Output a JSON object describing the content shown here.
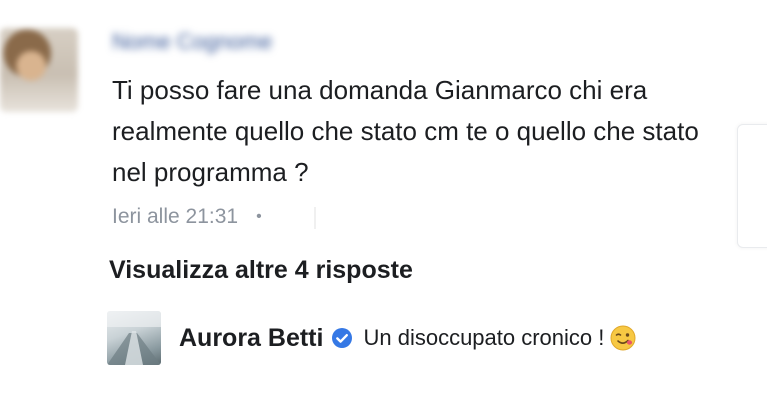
{
  "comment": {
    "author": "Nome Cognome",
    "text": "Ti posso fare una domanda Gianmarco chi era realmente quello che stato cm te o quello che stato nel programma ?",
    "timestamp": "Ieri alle 21:31",
    "separator": "•"
  },
  "more_replies": {
    "label": "Visualizza altre 4 risposte"
  },
  "reply": {
    "author": "Aurora Betti",
    "verified": true,
    "text": "Un disoccupato cronico !",
    "emoji": "wink-emoji-icon"
  },
  "colors": {
    "text": "#1c1e21",
    "secondary_text": "#8d949e",
    "verified_blue": "#3578e5",
    "emoji_yellow": "#f7c843"
  }
}
